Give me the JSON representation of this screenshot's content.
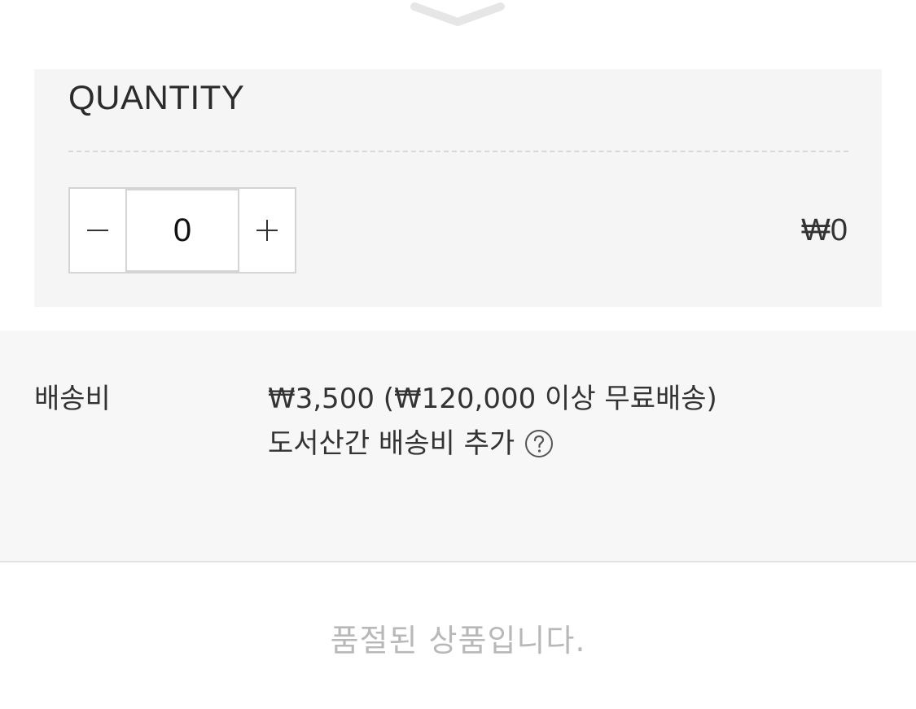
{
  "collapse_icon": "chevron-down-icon",
  "quantity": {
    "title": "QUANTITY",
    "value": "0",
    "decrement_icon": "minus-icon",
    "increment_icon": "plus-icon",
    "total_price": "₩0"
  },
  "shipping": {
    "label": "배송비",
    "fee_text": "₩3,500 (₩120,000 이상 무료배송)",
    "remote_text": "도서산간 배송비 추가",
    "help_icon": "question-circle-icon"
  },
  "status": {
    "sold_out_text": "품절된 상품입니다."
  },
  "colors": {
    "panel_bg": "#f5f5f5",
    "text": "#333333",
    "muted_text": "#b8b8b8",
    "border": "#d4d4d4"
  }
}
